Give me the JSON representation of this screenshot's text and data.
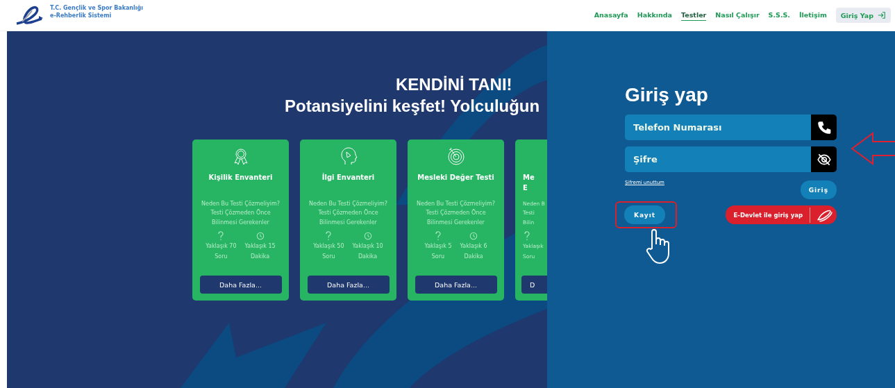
{
  "header": {
    "logo_line1": "T.C. Gençlik ve Spor Bakanlığı",
    "logo_line2": "e-Rehberlik Sistemi",
    "nav": [
      {
        "label": "Anasayfa",
        "selected": false
      },
      {
        "label": "Hakkında",
        "selected": false
      },
      {
        "label": "Testler",
        "selected": true
      },
      {
        "label": "Nasıl Çalışır",
        "selected": false
      },
      {
        "label": "S.S.S.",
        "selected": false
      },
      {
        "label": "İletişim",
        "selected": false
      }
    ],
    "login_button": "Giriş Yap"
  },
  "hero": {
    "title": "KENDİNİ TANI!",
    "subtitle": "Potansiyelini keşfet! Yolculuğun",
    "cards": [
      {
        "kind": "full",
        "title_lines": [
          "Kişilik Envanteri"
        ],
        "lines": [
          "Neden Bu Testi Çözmeliyim?",
          "Testi Çözmeden Önce",
          "Bilinmesi Gerekenler"
        ],
        "stats": [
          {
            "kind": "questions",
            "value": "Yaklaşık 70",
            "unit": "Soru"
          },
          {
            "kind": "time",
            "value": "Yaklaşık 15",
            "unit": "Dakika"
          }
        ],
        "button": "Daha Fazla..."
      },
      {
        "kind": "full",
        "title_lines": [
          "İlgi Envanteri"
        ],
        "lines": [
          "Neden Bu Testi Çözmeliyim?",
          "Testi Çözmeden Önce",
          "Bilinmesi Gerekenler"
        ],
        "stats": [
          {
            "kind": "questions",
            "value": "Yaklaşık 50",
            "unit": "Soru"
          },
          {
            "kind": "time",
            "value": "Yaklaşık 10",
            "unit": "Dakika"
          }
        ],
        "button": "Daha Fazla..."
      },
      {
        "kind": "full",
        "title_lines": [
          "Mesleki Değer Testi"
        ],
        "lines": [
          "Neden Bu Testi Çözmeliyim?",
          "Testi Çözmeden Önce",
          "Bilinmesi Gerekenler"
        ],
        "stats": [
          {
            "kind": "questions",
            "value": "Yaklaşık 5",
            "unit": "Soru"
          },
          {
            "kind": "time",
            "value": "Yaklaşık 6",
            "unit": "Dakika"
          }
        ],
        "button": "Daha Fazla..."
      },
      {
        "kind": "cut",
        "title_lines": [
          "Me",
          "E"
        ],
        "lines": [
          "Neden B",
          "Testi",
          "Bilin"
        ],
        "stats": [
          {
            "kind": "questions",
            "value": "Yaklaşık",
            "unit": "Soru"
          }
        ],
        "button": "D"
      }
    ]
  },
  "login": {
    "title": "Giriş yap",
    "fields": [
      {
        "kind": "phone",
        "placeholder": "Telefon Numarası"
      },
      {
        "kind": "password",
        "placeholder": "Şifre"
      }
    ],
    "forgot_link": "Şifremi unuttum",
    "submit": "Giriş",
    "register": "Kayıt",
    "edevlet": "E-Devlet ile giriş yap"
  }
}
